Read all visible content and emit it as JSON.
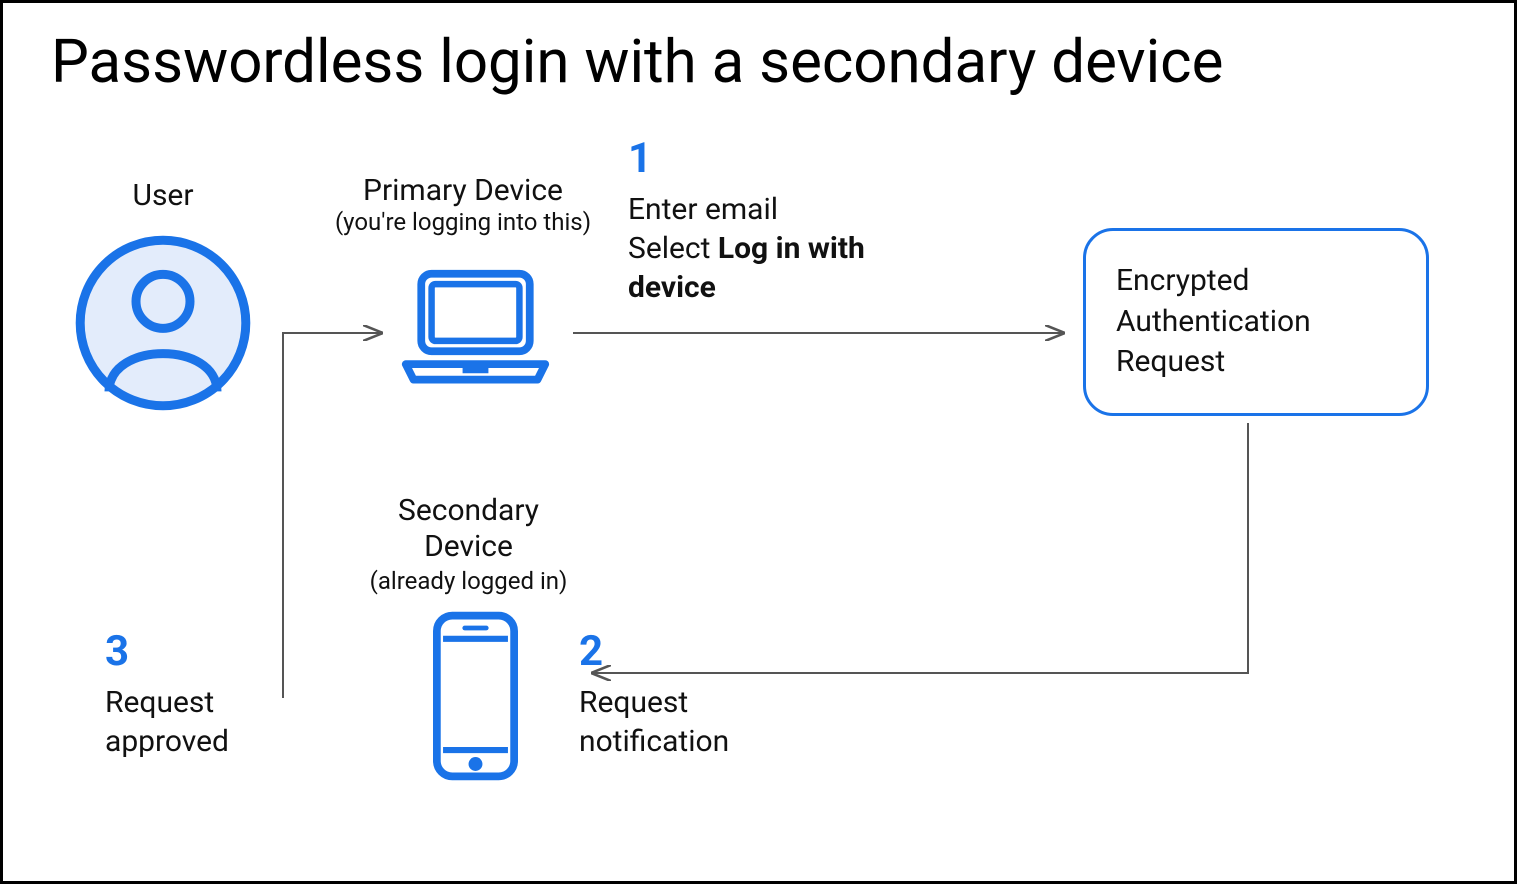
{
  "title": "Passwordless login with a secondary device",
  "user": {
    "label": "User"
  },
  "primary": {
    "label": "Primary Device",
    "sub": "(you're logging into this)"
  },
  "secondary": {
    "label": "Secondary Device",
    "sub": "(already logged in)"
  },
  "step1": {
    "num": "1",
    "line1": "Enter email",
    "line2a": "Select ",
    "line2b": "Log in with device"
  },
  "step2": {
    "num": "2",
    "text": "Request notification"
  },
  "step3": {
    "num": "3",
    "text": "Request approved"
  },
  "request_box": {
    "text": "Encrypted Authentication Request"
  },
  "colors": {
    "accent": "#1a73e8",
    "iconFill": "#e3ecfb"
  }
}
